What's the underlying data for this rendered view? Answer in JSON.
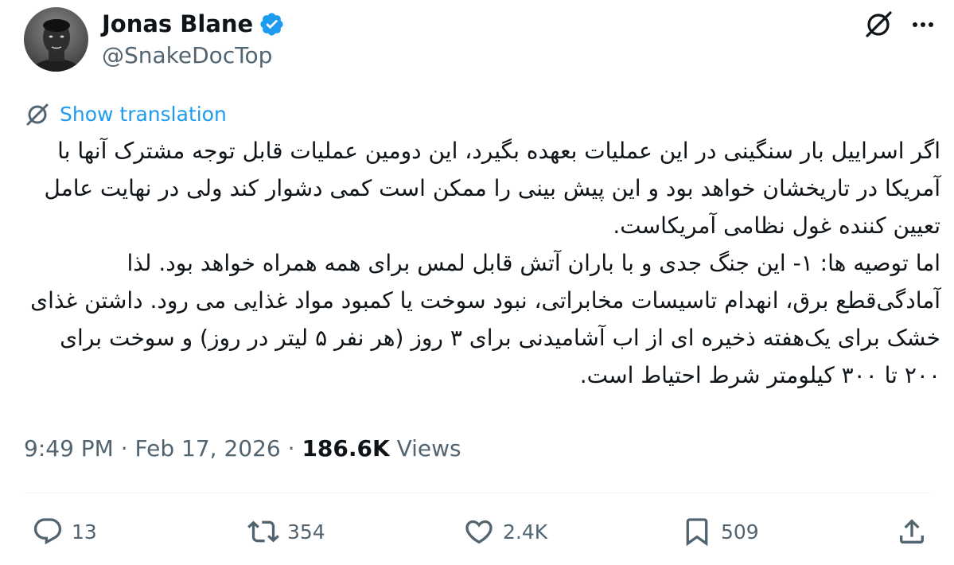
{
  "author": {
    "display_name": "Jonas Blane",
    "handle": "@SnakeDocTop",
    "verified": true,
    "avatar": "profile-photo"
  },
  "header_icons": [
    "grok-icon",
    "more-icon"
  ],
  "translation": {
    "label": "Show translation",
    "icon": "translate-icon"
  },
  "tweet": {
    "paragraphs": [
      "اگر اسراییل بار سنگینی در این عملیات بعهده بگیرد، این دومین عملیات قابل توجه مشترک آنها با آمریکا در تاریخشان خواهد بود و این پیش بینی را ممکن است کمی دشوار کند ولی در نهایت عامل تعیین کننده غول نظامی آمریکاست.",
      "اما توصیه ها: ۱- این جنگ جدی و با باران آتش قابل لمس برای همه همراه خواهد بود. لذا آمادگی‌قطع برق، انهدام تاسیسات مخابراتی، نبود سوخت یا کمبود مواد غذایی می رود. داشتن غذای خشک برای یک‌هفته ذخیره ای از اب آشامیدنی برای ۳ روز (هر نفر ۵ لیتر در روز) و سوخت برای ۲۰۰ تا ۳۰۰ کیلومتر شرط احتیاط است."
    ]
  },
  "meta": {
    "time": "9:49 PM",
    "separator": "·",
    "date": "Feb 17, 2026",
    "views_count": "186.6K",
    "views_label": "Views"
  },
  "actions": {
    "reply_count": "13",
    "retweet_count": "354",
    "like_count": "2.4K",
    "bookmark_count": "509"
  },
  "colors": {
    "accent": "#1d9bf0",
    "secondary_text": "#536471",
    "primary_text": "#0f1419",
    "divider": "#eff3f4"
  }
}
